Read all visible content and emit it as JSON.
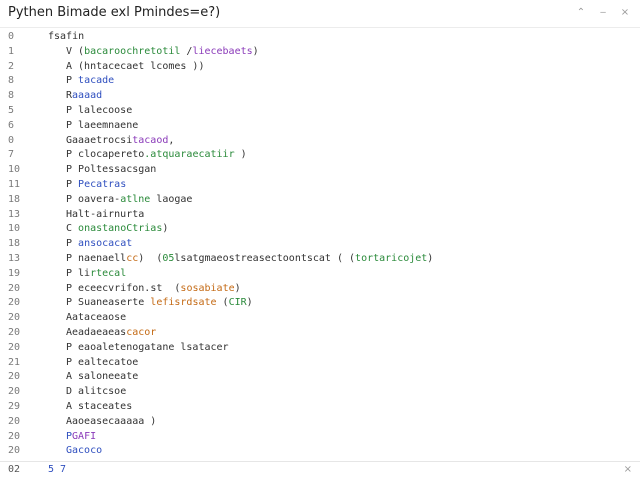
{
  "window": {
    "title": "Pythen Bimade exl Pmindes=e?)",
    "controls": {
      "restore": "⌃",
      "minimize": "‒",
      "close": "×"
    }
  },
  "editor": {
    "lines": [
      {
        "num": "0",
        "indent": 0,
        "parts": [
          {
            "text": "fsafin",
            "color": "#333333"
          }
        ]
      },
      {
        "num": "1",
        "indent": 1,
        "parts": [
          {
            "text": "V (",
            "color": "#333333"
          },
          {
            "text": "bacaroochretotil",
            "color": "#2a8a3a"
          },
          {
            "text": " /",
            "color": "#333333"
          },
          {
            "text": "liecebaets",
            "color": "#8a3ab9"
          },
          {
            "text": ")",
            "color": "#333333"
          }
        ]
      },
      {
        "num": "2",
        "indent": 1,
        "parts": [
          {
            "text": "A (hntacecaet lcomes )",
            "color": "#333333"
          },
          {
            "text": ")",
            "color": "#333333"
          }
        ]
      },
      {
        "num": "8",
        "indent": 1,
        "parts": [
          {
            "text": "P ",
            "color": "#333333"
          },
          {
            "text": "tacade",
            "color": "#2f4fbf"
          }
        ]
      },
      {
        "num": "8",
        "indent": 1,
        "parts": [
          {
            "text": "R",
            "color": "#333333"
          },
          {
            "text": "aaaad",
            "color": "#2f4fbf"
          }
        ]
      },
      {
        "num": "5",
        "indent": 1,
        "parts": [
          {
            "text": "P lalecoose",
            "color": "#333333"
          }
        ]
      },
      {
        "num": "6",
        "indent": 1,
        "parts": [
          {
            "text": "P laeemnaene",
            "color": "#333333"
          }
        ]
      },
      {
        "num": "0",
        "indent": 1,
        "parts": [
          {
            "text": "Gaaaetrocsi",
            "color": "#333333"
          },
          {
            "text": "tacaod",
            "color": "#8a3ab9"
          },
          {
            "text": ",",
            "color": "#333333"
          }
        ]
      },
      {
        "num": "7",
        "indent": 1,
        "parts": [
          {
            "text": "P ",
            "color": "#333333"
          },
          {
            "text": "clocapereto",
            "color": "#333333"
          },
          {
            "text": ".atquaraecatiir",
            "color": "#2a8a3a"
          },
          {
            "text": " )",
            "color": "#333333"
          }
        ]
      },
      {
        "num": "10",
        "indent": 1,
        "parts": [
          {
            "text": "P ",
            "color": "#333333"
          },
          {
            "text": "Poltessacsgan",
            "color": "#333333"
          }
        ]
      },
      {
        "num": "11",
        "indent": 1,
        "parts": [
          {
            "text": "P ",
            "color": "#333333"
          },
          {
            "text": "Pecatras",
            "color": "#2f4fbf"
          }
        ]
      },
      {
        "num": "18",
        "indent": 1,
        "parts": [
          {
            "text": "P ",
            "color": "#333333"
          },
          {
            "text": "oavera-",
            "color": "#333333"
          },
          {
            "text": "atlne",
            "color": "#2a8a3a"
          },
          {
            "text": " laogae",
            "color": "#333333"
          }
        ]
      },
      {
        "num": "13",
        "indent": 1,
        "parts": [
          {
            "text": "Halt-airnurta",
            "color": "#333333"
          }
        ]
      },
      {
        "num": "10",
        "indent": 1,
        "parts": [
          {
            "text": "C ",
            "color": "#333333"
          },
          {
            "text": "onastanoCtrias",
            "color": "#2a8a3a"
          },
          {
            "text": ")",
            "color": "#333333"
          }
        ]
      },
      {
        "num": "18",
        "indent": 1,
        "parts": [
          {
            "text": "P ",
            "color": "#333333"
          },
          {
            "text": "ansocacat",
            "color": "#2f4fbf"
          }
        ]
      },
      {
        "num": "13",
        "indent": 1,
        "parts": [
          {
            "text": "P naenaell",
            "color": "#333333"
          },
          {
            "text": "cc",
            "color": "#c46a15"
          },
          {
            "text": ")  (",
            "color": "#333333"
          },
          {
            "text": "05",
            "color": "#2a8a3a"
          },
          {
            "text": "lsatgmaeostreasectoontscat",
            "color": "#333333"
          },
          {
            "text": " ( (",
            "color": "#333333"
          },
          {
            "text": "tortaricojet",
            "color": "#2a8a3a"
          },
          {
            "text": ")",
            "color": "#333333"
          }
        ]
      },
      {
        "num": "19",
        "indent": 1,
        "parts": [
          {
            "text": "P li",
            "color": "#333333"
          },
          {
            "text": "rtecal",
            "color": "#2a8a3a"
          }
        ]
      },
      {
        "num": "20",
        "indent": 1,
        "parts": [
          {
            "text": "P ",
            "color": "#333333"
          },
          {
            "text": "eceecvrifon",
            "color": "#333333"
          },
          {
            "text": ".",
            "color": "#333333"
          },
          {
            "text": "st",
            "color": "#333333"
          },
          {
            "text": "  (",
            "color": "#333333"
          },
          {
            "text": "sosabiate",
            "color": "#c46a15"
          },
          {
            "text": ")",
            "color": "#333333"
          }
        ]
      },
      {
        "num": "20",
        "indent": 1,
        "parts": [
          {
            "text": "P ",
            "color": "#333333"
          },
          {
            "text": "Suaneaserte",
            "color": "#333333"
          },
          {
            "text": " lefisrdsate",
            "color": "#c46a15"
          },
          {
            "text": " (",
            "color": "#333333"
          },
          {
            "text": "CIR",
            "color": "#2a8a3a"
          },
          {
            "text": ")",
            "color": "#333333"
          }
        ]
      },
      {
        "num": "20",
        "indent": 1,
        "parts": [
          {
            "text": "Aataceaose",
            "color": "#333333"
          }
        ]
      },
      {
        "num": "20",
        "indent": 1,
        "parts": [
          {
            "text": "Aeadaeaeas",
            "color": "#333333"
          },
          {
            "text": "cacor",
            "color": "#c46a15"
          }
        ]
      },
      {
        "num": "20",
        "indent": 1,
        "parts": [
          {
            "text": "P eaoaleteno",
            "color": "#333333"
          },
          {
            "text": "gatane",
            "color": "#333333"
          },
          {
            "text": " lsatacer",
            "color": "#333333"
          }
        ]
      },
      {
        "num": "21",
        "indent": 1,
        "parts": [
          {
            "text": "P ",
            "color": "#333333"
          },
          {
            "text": "ealtecatoe",
            "color": "#333333"
          }
        ]
      },
      {
        "num": "20",
        "indent": 1,
        "parts": [
          {
            "text": "A saloneeate",
            "color": "#333333"
          }
        ]
      },
      {
        "num": "20",
        "indent": 1,
        "parts": [
          {
            "text": "D ",
            "color": "#333333"
          },
          {
            "text": "alitcsoe",
            "color": "#333333"
          }
        ]
      },
      {
        "num": "29",
        "indent": 1,
        "parts": [
          {
            "text": "A staceates",
            "color": "#333333"
          }
        ]
      },
      {
        "num": "20",
        "indent": 1,
        "parts": [
          {
            "text": "Aaoeasecaaaaa",
            "color": "#333333"
          },
          {
            "text": " )",
            "color": "#333333"
          }
        ]
      },
      {
        "num": "20",
        "indent": 1,
        "parts": [
          {
            "text": "P",
            "color": "#2f4fbf"
          },
          {
            "text": "GAFI",
            "color": "#8a3ab9"
          }
        ]
      },
      {
        "num": "20",
        "indent": 1,
        "parts": [
          {
            "text": "Gacoco",
            "color": "#2f4fbf"
          }
        ]
      }
    ]
  },
  "status": {
    "left": "02",
    "position": "5 7",
    "close": "×"
  }
}
